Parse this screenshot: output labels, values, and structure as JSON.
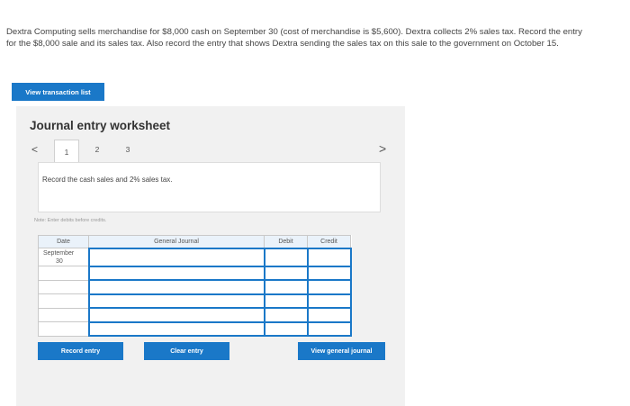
{
  "problem": {
    "text": "Dextra Computing sells merchandise for $8,000 cash on September 30 (cost of merchandise is $5,600). Dextra collects 2% sales tax. Record the entry for the $8,000 sale and its sales tax. Also record the entry that shows Dextra sending the sales tax on this sale to the government on October 15."
  },
  "buttons": {
    "view_transaction_list": "View transaction list",
    "record_entry": "Record entry",
    "clear_entry": "Clear entry",
    "view_general_journal": "View general journal"
  },
  "worksheet": {
    "title": "Journal entry worksheet",
    "prev_icon": "<",
    "next_icon": ">",
    "tabs": [
      "1",
      "2",
      "3"
    ],
    "active_tab": "1",
    "instruction": "Record the cash sales and 2% sales tax.",
    "note": "Note: Enter debits before credits."
  },
  "journal": {
    "headers": {
      "date": "Date",
      "account": "General Journal",
      "debit": "Debit",
      "credit": "Credit"
    },
    "date_value": "September\n30",
    "date_line1": "September",
    "date_line2": "30",
    "row_count": 6
  },
  "colors": {
    "primary": "#1a78c8",
    "header_bg": "#eaf2fa",
    "panel_bg": "#f1f1f1"
  }
}
